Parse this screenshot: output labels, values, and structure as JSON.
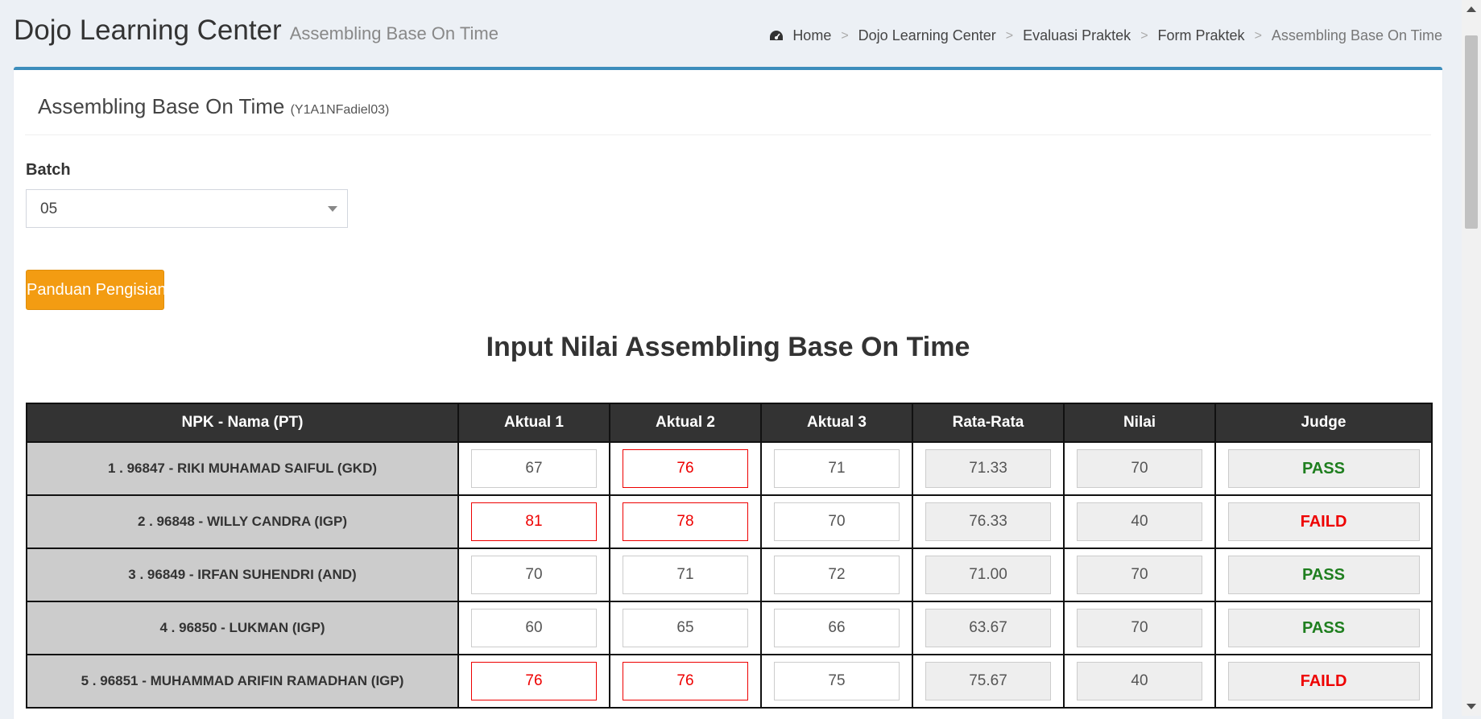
{
  "header": {
    "title": "Dojo Learning Center",
    "subtitle": "Assembling Base On Time"
  },
  "breadcrumb": {
    "icon": "dashboard-icon",
    "items": [
      "Home",
      "Dojo Learning Center",
      "Evaluasi Praktek",
      "Form Praktek",
      "Assembling Base On Time"
    ],
    "separator": ">"
  },
  "box": {
    "title": "Assembling Base On Time",
    "code": "(Y1A1NFadiel03)"
  },
  "batch": {
    "label": "Batch",
    "selected": "05"
  },
  "guide_button": {
    "label": "Panduan Pengisian"
  },
  "form_heading": "Input Nilai Assembling Base On Time",
  "table": {
    "headers": [
      "NPK - Nama (PT)",
      "Aktual 1",
      "Aktual 2",
      "Aktual 3",
      "Rata-Rata",
      "Nilai",
      "Judge"
    ],
    "rows": [
      {
        "name": "1 . 96847 - RIKI MUHAMAD SAIFUL (GKD)",
        "a1": "67",
        "a2": "76",
        "a3": "71",
        "avg": "71.33",
        "nilai": "70",
        "judge": "PASS"
      },
      {
        "name": "2 . 96848 - WILLY CANDRA (IGP)",
        "a1": "81",
        "a2": "78",
        "a3": "70",
        "avg": "76.33",
        "nilai": "40",
        "judge": "FAILD"
      },
      {
        "name": "3 . 96849 - IRFAN SUHENDRI (AND)",
        "a1": "70",
        "a2": "71",
        "a3": "72",
        "avg": "71.00",
        "nilai": "70",
        "judge": "PASS"
      },
      {
        "name": "4 . 96850 - LUKMAN (IGP)",
        "a1": "60",
        "a2": "65",
        "a3": "66",
        "avg": "63.67",
        "nilai": "70",
        "judge": "PASS"
      },
      {
        "name": "5 . 96851 - MUHAMMAD ARIFIN RAMADHAN (IGP)",
        "a1": "76",
        "a2": "76",
        "a3": "75",
        "avg": "75.67",
        "nilai": "40",
        "judge": "FAILD"
      }
    ]
  },
  "colors": {
    "accent": "#3c8dbc",
    "warning_button": "#f39c12",
    "pass": "#1e7e1e",
    "fail": "#e00000"
  }
}
